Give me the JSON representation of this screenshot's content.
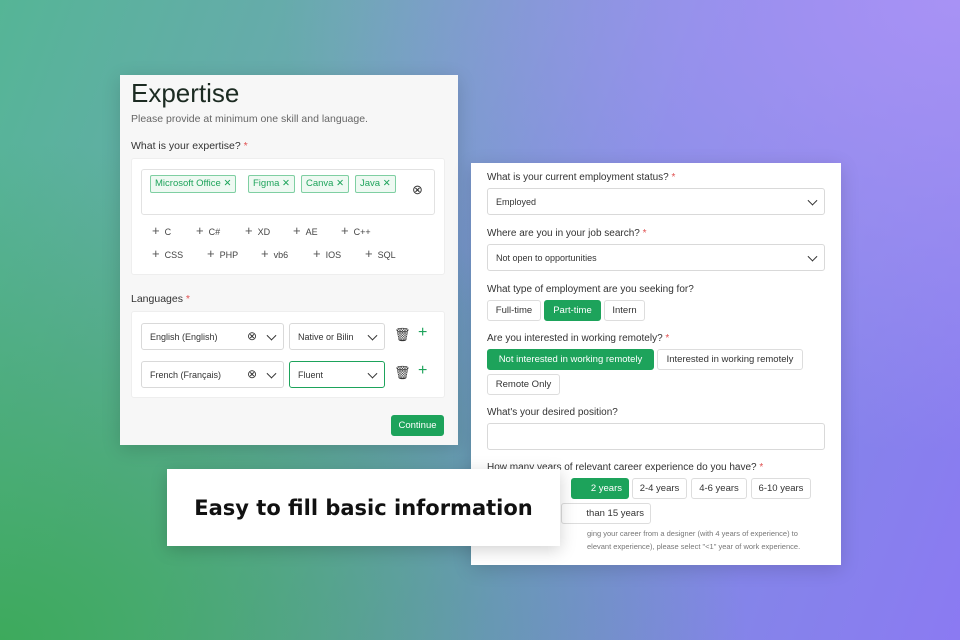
{
  "expertise": {
    "title": "Expertise",
    "subtitle": "Please provide at minimum one skill and language.",
    "question": "What is your expertise?",
    "required": "*",
    "tags": [
      "Microsoft Office",
      "Figma",
      "Canva",
      "Java"
    ],
    "suggestions": [
      "C",
      "C#",
      "XD",
      "AE",
      "C++",
      "CSS",
      "PHP",
      "vb6",
      "IOS",
      "SQL"
    ],
    "languages_label": "Languages",
    "languages": [
      {
        "language": "English (English)",
        "level": "Native or Bilin"
      },
      {
        "language": "French (Français)",
        "level": "Fluent"
      }
    ],
    "continue": "Continue"
  },
  "profile": {
    "employment_status": {
      "label": "What is your current employment status?",
      "value": "Employed"
    },
    "job_search": {
      "label": "Where are you in your job search?",
      "value": "Not open to opportunities"
    },
    "employment_type": {
      "label": "What type of employment are you seeking for?",
      "options": [
        "Full-time",
        "Part-time",
        "Intern"
      ]
    },
    "remote": {
      "label": "Are you interested in working remotely?",
      "options": [
        "Not interested in working remotely",
        "Interested in working remotely",
        "Remote Only"
      ]
    },
    "position": {
      "label": "What's your desired position?",
      "value": ""
    },
    "experience": {
      "label": "How many years of relevant career experience do you have?",
      "options": [
        "2 years",
        "2-4 years",
        "4-6 years",
        "6-10 years",
        "than 15 years"
      ],
      "note_line1": "ging your career from a designer (with 4 years of experience) to",
      "note_line2": "elevant experience), please select \"<1\" year of work experience."
    }
  },
  "banner": "Easy to fill basic information",
  "colors": {
    "accent": "#1da35b"
  }
}
